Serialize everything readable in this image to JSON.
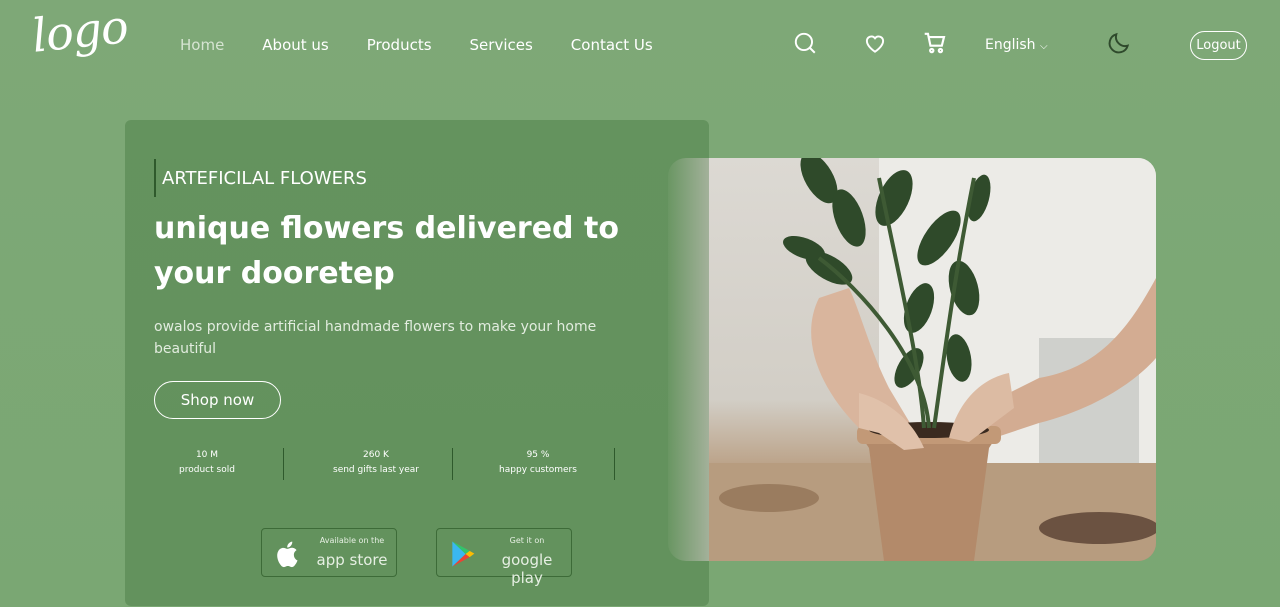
{
  "brand": {
    "logo_text": "logo"
  },
  "nav": {
    "items": [
      {
        "label": "Home",
        "active": true
      },
      {
        "label": "About us"
      },
      {
        "label": "Products"
      },
      {
        "label": "Services"
      },
      {
        "label": "Contact Us"
      }
    ]
  },
  "header": {
    "icons": [
      "search-icon",
      "heart-icon",
      "cart-icon",
      "moon-icon"
    ],
    "language": "English",
    "logout_label": "Logout"
  },
  "hero": {
    "kicker": "ARTEFICILAL FLOWERS",
    "headline": "unique flowers delivered to your dooretep",
    "description": "owalos provide artificial handmade flowers to make your home beautiful",
    "cta_label": "Shop now",
    "stats": [
      {
        "value": "10 M",
        "label": "product sold"
      },
      {
        "value": "260 K",
        "label": "send gifts last year"
      },
      {
        "value": "95 %",
        "label": "happy customers"
      }
    ],
    "stores": [
      {
        "small": "Available on the",
        "big": "app store",
        "icon": "apple-icon"
      },
      {
        "small": "Get it on",
        "big": "google play",
        "icon": "google-play-icon"
      }
    ]
  },
  "colors": {
    "background": "#7ea877",
    "card": "#5f8c58",
    "accent_dark": "#2f5a2c"
  }
}
